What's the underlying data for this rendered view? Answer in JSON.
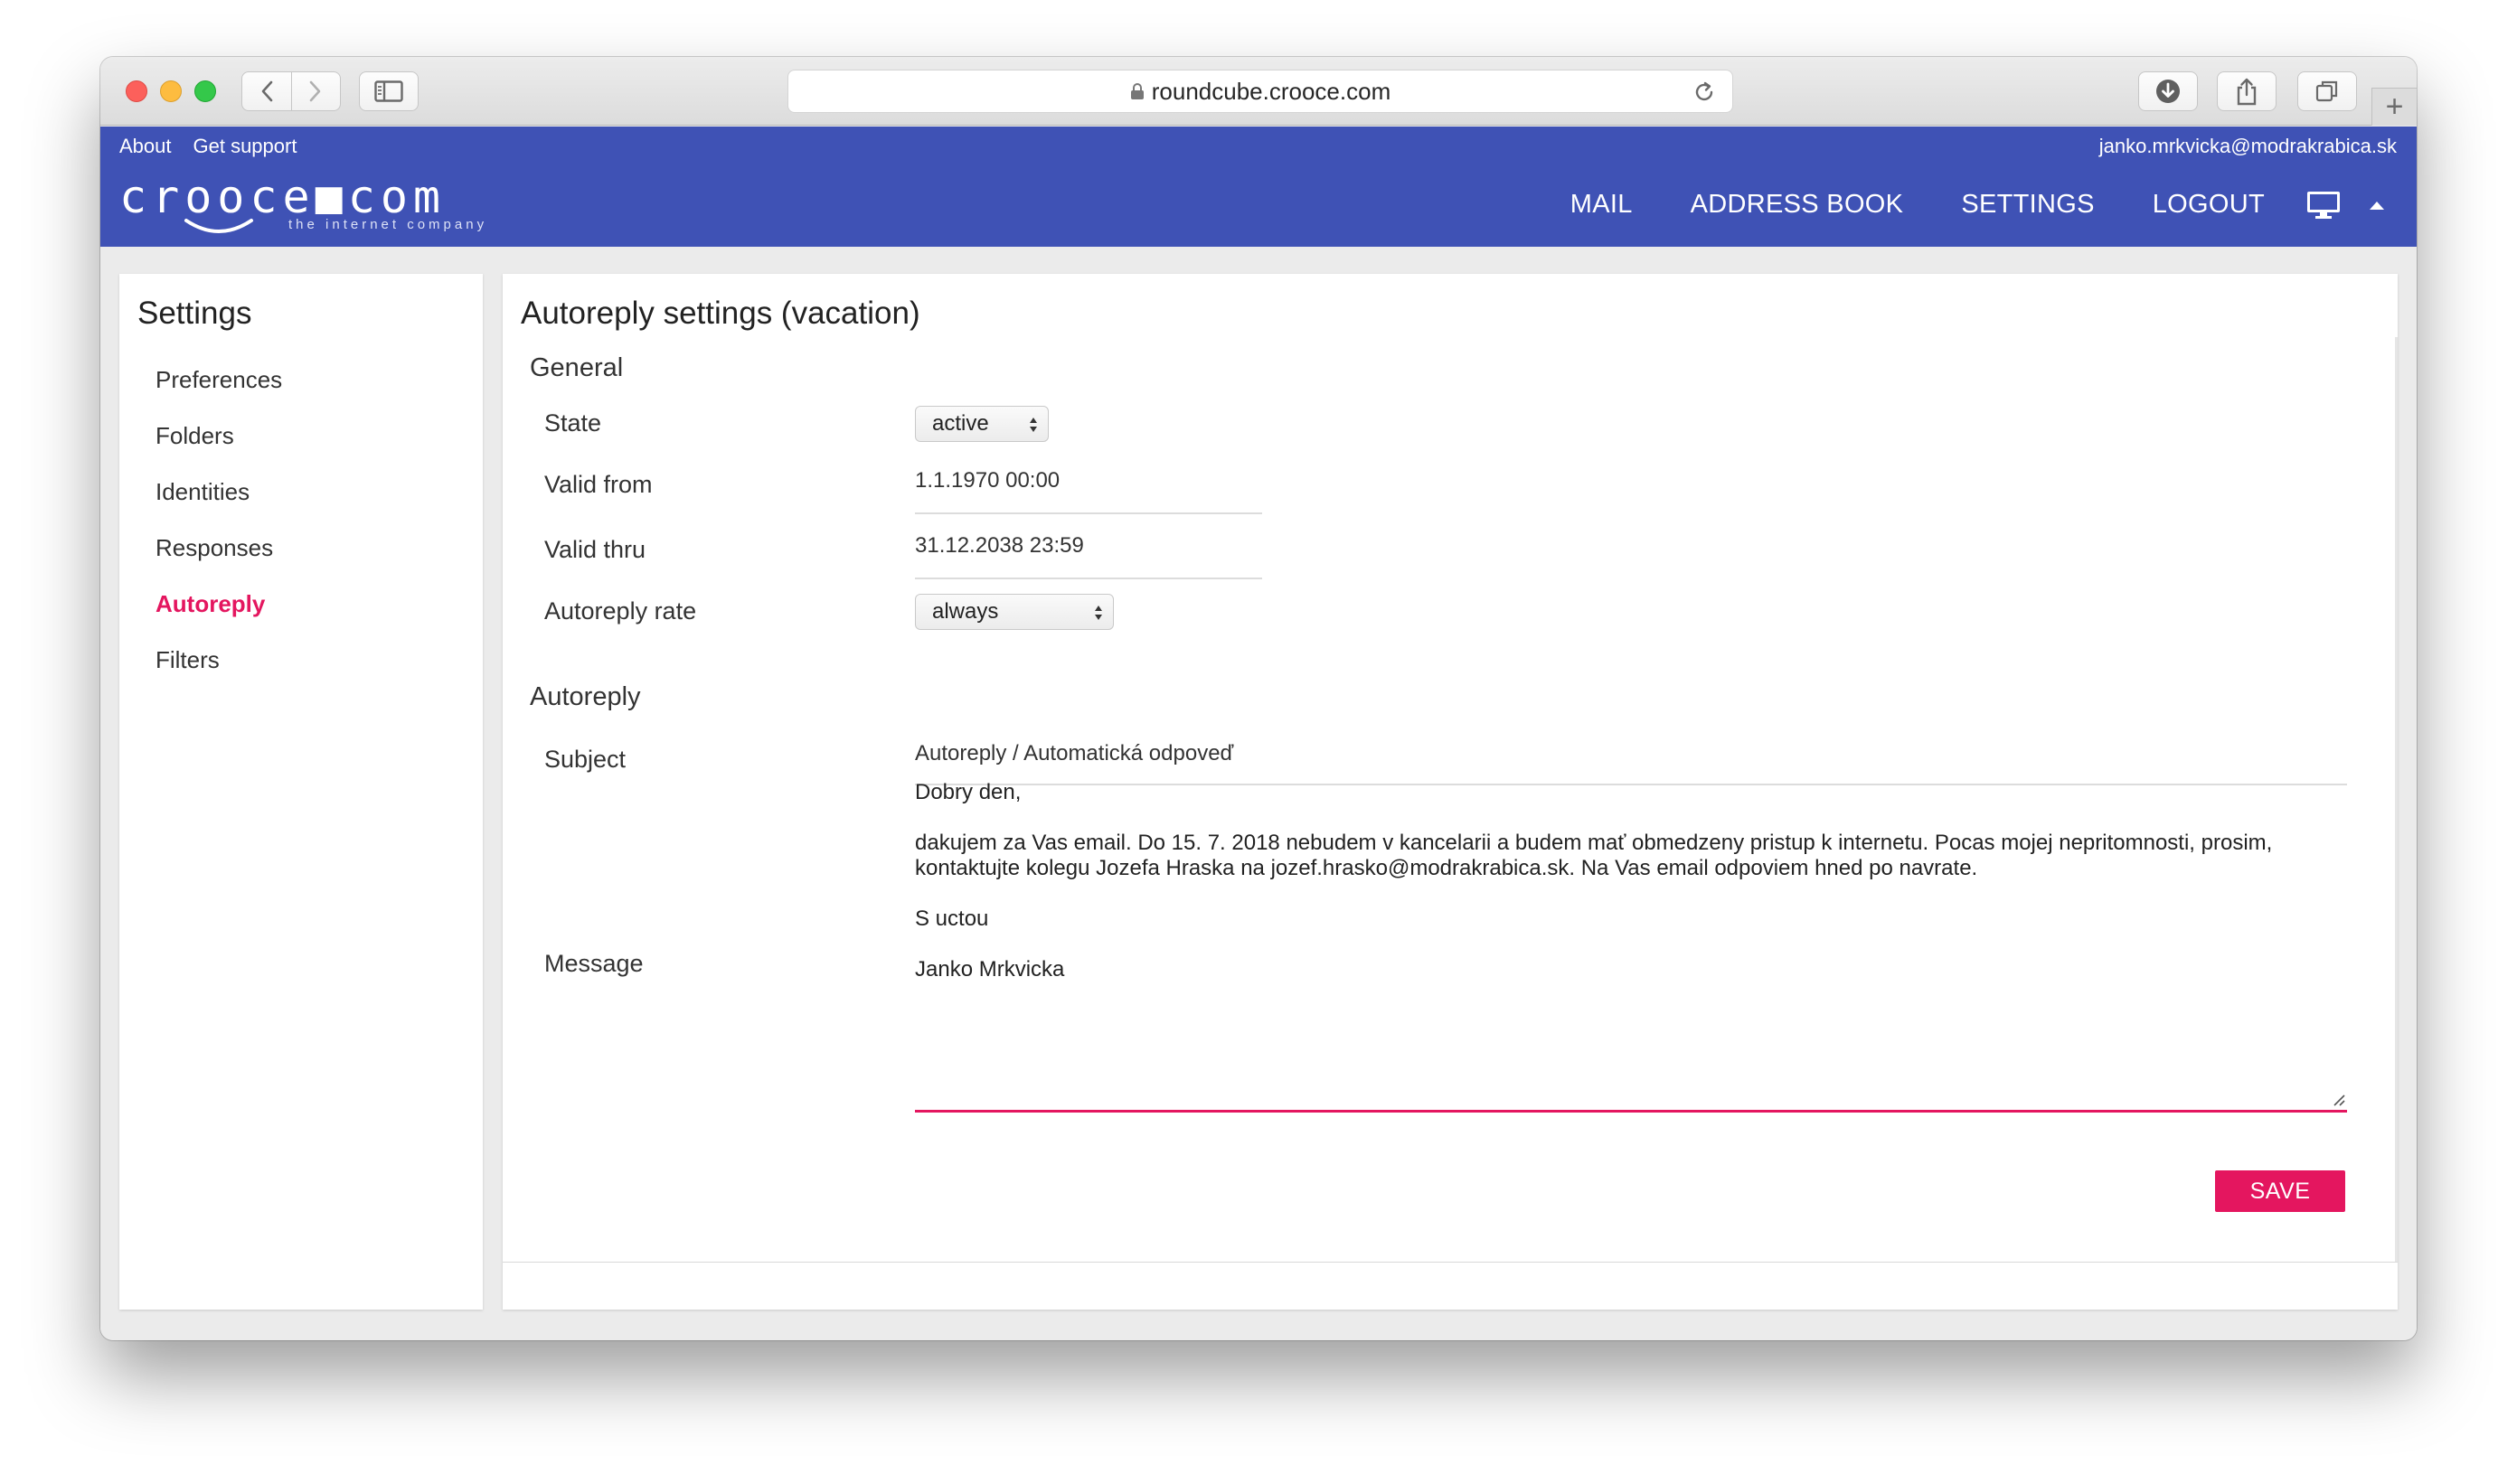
{
  "browser": {
    "url": "roundcube.crooce.com",
    "new_tab": "+"
  },
  "header": {
    "links": [
      "About",
      "Get support"
    ],
    "user_email": "janko.mrkvicka@modrakrabica.sk",
    "logo": {
      "word": "crooce■com",
      "tagline": "the internet company"
    },
    "nav": [
      "MAIL",
      "ADDRESS BOOK",
      "SETTINGS",
      "LOGOUT"
    ],
    "icons": [
      "monitor-icon",
      "caret-up-icon"
    ]
  },
  "sidebar": {
    "title": "Settings",
    "items": [
      {
        "label": "Preferences"
      },
      {
        "label": "Folders"
      },
      {
        "label": "Identities"
      },
      {
        "label": "Responses"
      },
      {
        "label": "Autoreply",
        "active": true
      },
      {
        "label": "Filters"
      }
    ],
    "active_color": "#e4165f"
  },
  "main": {
    "title": "Autoreply settings (vacation)",
    "general": {
      "heading": "General",
      "state": {
        "label": "State",
        "value": "active"
      },
      "valid_from": {
        "label": "Valid from",
        "value": "1.1.1970 00:00"
      },
      "valid_thru": {
        "label": "Valid thru",
        "value": "31.12.2038 23:59"
      },
      "rate": {
        "label": "Autoreply rate",
        "value": "always"
      }
    },
    "autoreply": {
      "heading": "Autoreply",
      "subject": {
        "label": "Subject",
        "value": "Autoreply / Automatická odpoveď"
      },
      "message": {
        "label": "Message",
        "lines": [
          "Dobry den,",
          "dakujem za Vas email. Do 15. 7. 2018 nebudem v kancelarii a budem mať obmedzeny pristup k internetu. Pocas mojej nepritomnosti, prosim, kontaktujte kolegu Jozefa Hraska na jozef.hrasko@modrakrabica.sk. Na Vas email odpoviem hned po navrate.",
          "S uctou",
          "Janko Mrkvicka"
        ]
      }
    },
    "save_label": "SAVE"
  },
  "colors": {
    "header_bg": "#3f52b5",
    "accent": "#e4165f"
  }
}
